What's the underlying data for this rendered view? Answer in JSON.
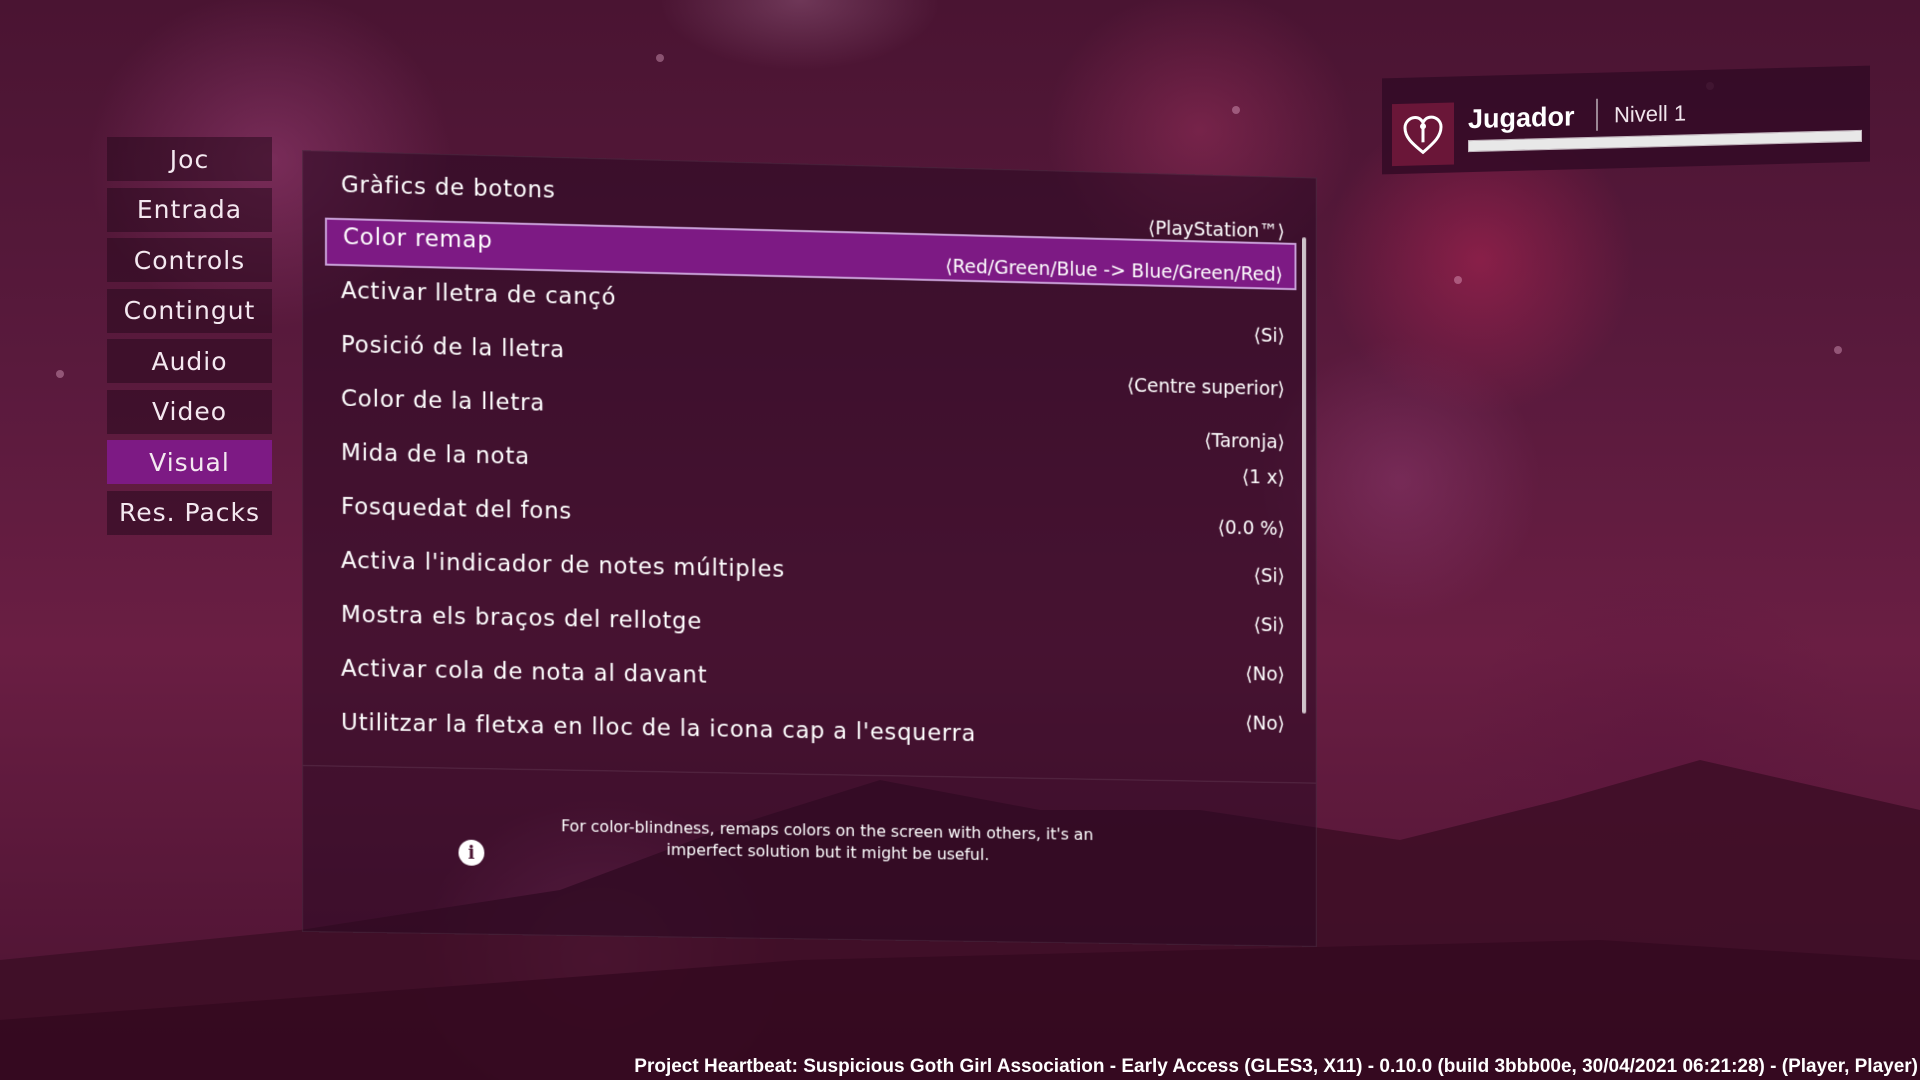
{
  "sidebar": {
    "items": [
      {
        "label": "Joc"
      },
      {
        "label": "Entrada"
      },
      {
        "label": "Controls"
      },
      {
        "label": "Contingut"
      },
      {
        "label": "Audio"
      },
      {
        "label": "Video"
      },
      {
        "label": "Visual"
      },
      {
        "label": "Res. Packs"
      }
    ],
    "active": "Visual"
  },
  "settings": [
    {
      "label": "Gràfics de botons",
      "value": "⟨PlayStation™⟩"
    },
    {
      "label": "Color remap",
      "value": "⟨Red/Green/Blue -> Blue/Green/Red⟩"
    },
    {
      "label": "Activar lletra de cançó",
      "value": "⟨Si⟩"
    },
    {
      "label": "Posició de la lletra",
      "value": "⟨Centre superior⟩"
    },
    {
      "label": "Color de la lletra",
      "value": "⟨Taronja⟩"
    },
    {
      "label": "Mida de la nota",
      "value": "⟨1 x⟩"
    },
    {
      "label": "Fosquedat del fons",
      "value": "⟨0.0 %⟩"
    },
    {
      "label": "Activa l'indicador de notes múltiples",
      "value": "⟨Si⟩"
    },
    {
      "label": "Mostra els braços del rellotge",
      "value": "⟨Si⟩"
    },
    {
      "label": "Activar cola de nota al davant",
      "value": "⟨No⟩"
    },
    {
      "label": "Utilitzar la fletxa en lloc de la icona cap a l'esquerra",
      "value": "⟨No⟩"
    }
  ],
  "selected_setting": "Color remap",
  "info": {
    "icon": "info-icon",
    "text": "For color-blindness, remaps colors on the screen with others, it's an imperfect solution but it might be useful."
  },
  "player": {
    "name": "Jugador",
    "level": "Nivell 1",
    "xp_fraction": 1.0,
    "avatar_icon": "heart-shield-icon"
  },
  "footer": {
    "build_info": "Project Heartbeat: Suspicious Goth Girl Association - Early Access (GLES3, X11) - 0.10.0 (build 3bbb00e, 30/04/2021  06:21:28) - (Player, Player)"
  },
  "colors": {
    "accent": "#7d1a84",
    "background": "#5a1a3d"
  }
}
